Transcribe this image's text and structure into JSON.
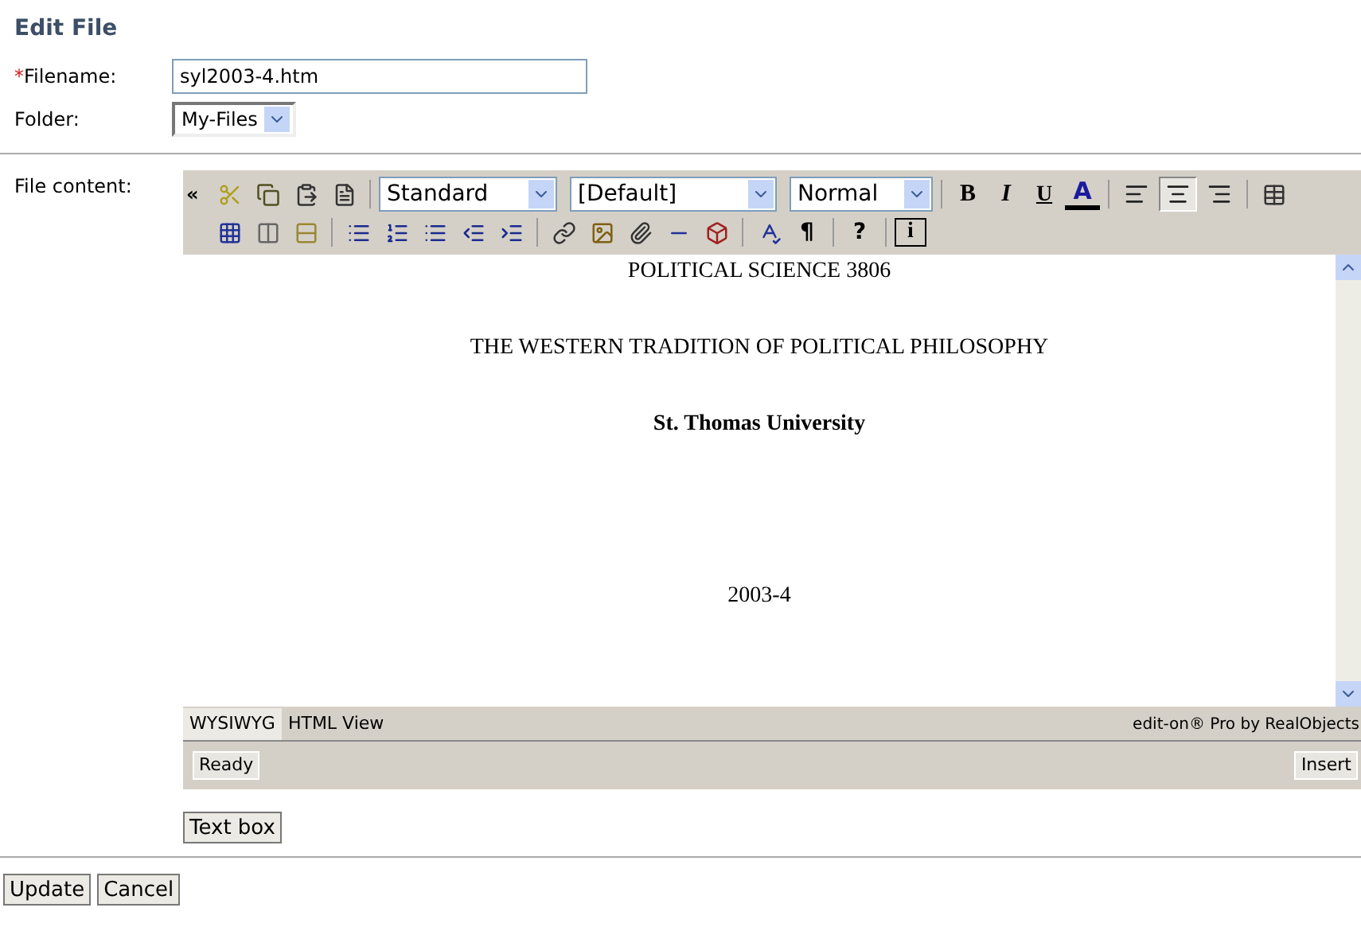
{
  "title": "Edit File",
  "filename": {
    "required_mark": "*",
    "label": "Filename:",
    "value": "syl2003-4.htm"
  },
  "folder": {
    "label": "Folder:",
    "value": "My-Files"
  },
  "content_label": "File content:",
  "toolbar": {
    "collapse": "«",
    "selects": [
      "Standard",
      "[Default]",
      "Normal"
    ],
    "bold": "B",
    "italic": "I",
    "underline": "U",
    "text_color": "A",
    "alignments": [
      {
        "selected": false
      },
      {
        "selected": true
      },
      {
        "selected": false
      }
    ],
    "help": "?",
    "paragraph": "¶",
    "info": "i"
  },
  "document": [
    {
      "kind": "text",
      "text": "POLITICAL SCIENCE 3806"
    },
    {
      "kind": "text",
      "text": "THE WESTERN TRADITION OF POLITICAL PHILOSOPHY"
    },
    {
      "kind": "bold",
      "text": "St. Thomas University"
    },
    {
      "kind": "gap"
    },
    {
      "kind": "text",
      "text": "2003-4"
    }
  ],
  "tabs": [
    {
      "label": "WYSIWYG",
      "selected": true
    },
    {
      "label": "HTML View",
      "selected": false
    }
  ],
  "credit": "edit-on® Pro by RealObjects",
  "status": {
    "left": "Ready",
    "right": "Insert"
  },
  "text_box_button": "Text box",
  "buttons": [
    "Update",
    "Cancel"
  ]
}
